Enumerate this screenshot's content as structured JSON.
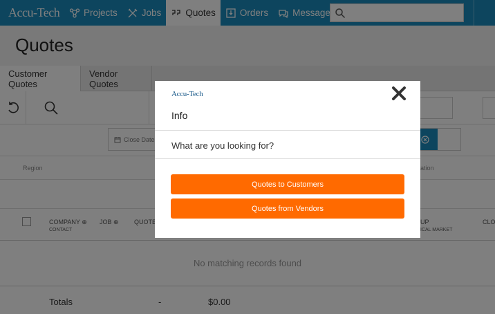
{
  "brand": "Accu-Tech",
  "nav": {
    "items": [
      {
        "label": "Projects",
        "icon": "projects-icon"
      },
      {
        "label": "Jobs",
        "icon": "jobs-icon"
      },
      {
        "label": "Quotes",
        "icon": "quotes-icon"
      },
      {
        "label": "Orders",
        "icon": "orders-icon"
      },
      {
        "label": "Messages",
        "icon": "messages-icon"
      }
    ],
    "search_placeholder": ""
  },
  "page": {
    "title": "Quotes",
    "tabs": [
      "Customer Quotes",
      "Vendor Quotes"
    ],
    "filters": {
      "close_date": "Close Date"
    },
    "region_label": "Region",
    "ation_label": "ation",
    "columns": {
      "company": "COMPANY",
      "contact": "CONTACT",
      "job": "JOB",
      "quote": "QUOTE",
      "group": "UP",
      "vertical_market": "ICAL MARKET",
      "close": "CLO"
    },
    "no_records": "No matching records found",
    "totals": {
      "label": "Totals",
      "dash": "-",
      "amount": "$0.00"
    }
  },
  "modal": {
    "logo": "Accu-Tech",
    "title": "Info",
    "question": "What are you looking for?",
    "btn_customers": "Quotes to Customers",
    "btn_vendors": "Quotes from Vendors"
  },
  "colors": {
    "nav": "#1a8bbd",
    "accent": "#ff6a00"
  }
}
